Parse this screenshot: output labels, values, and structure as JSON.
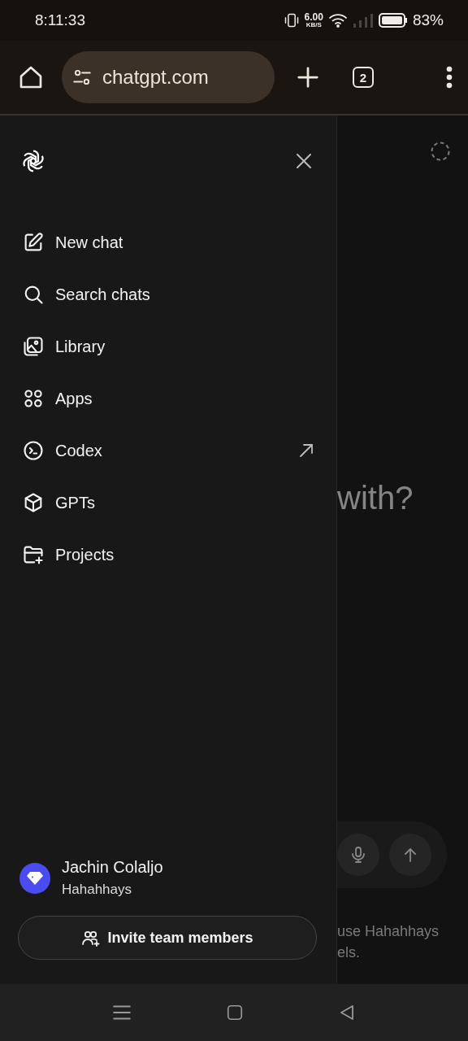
{
  "status_bar": {
    "time": "8:11:33",
    "speed": "6.00",
    "speed_unit": "KB/S",
    "battery": "83%"
  },
  "browser": {
    "url": "chatgpt.com",
    "tab_count": "2"
  },
  "sidebar": {
    "items": [
      {
        "label": "New chat",
        "external": false
      },
      {
        "label": "Search chats",
        "external": false
      },
      {
        "label": "Library",
        "external": false
      },
      {
        "label": "Apps",
        "external": false
      },
      {
        "label": "Codex",
        "external": true
      },
      {
        "label": "GPTs",
        "external": false
      },
      {
        "label": "Projects",
        "external": false
      }
    ],
    "profile": {
      "name": "Jachin Colaljo",
      "workspace": "Hahahhays"
    },
    "invite_button": "Invite team members"
  },
  "background": {
    "heading": "with?",
    "footer_lines": [
      "use Hahahhays",
      "els."
    ]
  }
}
